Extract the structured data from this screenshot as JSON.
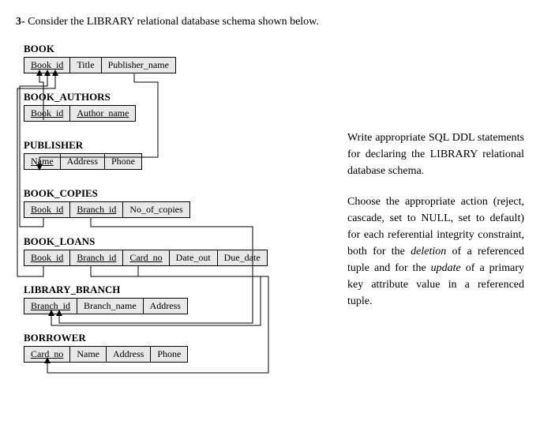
{
  "question": {
    "number": "3-",
    "text": "Consider the LIBRARY relational database schema shown below."
  },
  "schema": {
    "relations": [
      {
        "name": "BOOK",
        "attrs": [
          {
            "label": "Book_id",
            "pk": true
          },
          {
            "label": "Title",
            "pk": false
          },
          {
            "label": "Publisher_name",
            "pk": false
          }
        ]
      },
      {
        "name": "BOOK_AUTHORS",
        "attrs": [
          {
            "label": "Book_id",
            "pk": true
          },
          {
            "label": "Author_name",
            "pk": true
          }
        ]
      },
      {
        "name": "PUBLISHER",
        "attrs": [
          {
            "label": "Name",
            "pk": true
          },
          {
            "label": "Address",
            "pk": false
          },
          {
            "label": "Phone",
            "pk": false
          }
        ]
      },
      {
        "name": "BOOK_COPIES",
        "attrs": [
          {
            "label": "Book_id",
            "pk": true
          },
          {
            "label": "Branch_id",
            "pk": true
          },
          {
            "label": "No_of_copies",
            "pk": false
          }
        ]
      },
      {
        "name": "BOOK_LOANS",
        "attrs": [
          {
            "label": "Book_id",
            "pk": true
          },
          {
            "label": "Branch_id",
            "pk": true
          },
          {
            "label": "Card_no",
            "pk": true
          },
          {
            "label": "Date_out",
            "pk": false
          },
          {
            "label": "Due_date",
            "pk": false
          }
        ]
      },
      {
        "name": "LIBRARY_BRANCH",
        "attrs": [
          {
            "label": "Branch_id",
            "pk": true
          },
          {
            "label": "Branch_name",
            "pk": false
          },
          {
            "label": "Address",
            "pk": false
          }
        ]
      },
      {
        "name": "BORROWER",
        "attrs": [
          {
            "label": "Card_no",
            "pk": true
          },
          {
            "label": "Name",
            "pk": false
          },
          {
            "label": "Address",
            "pk": false
          },
          {
            "label": "Phone",
            "pk": false
          }
        ]
      }
    ]
  },
  "instructions": {
    "p1_a": "Write appropriate SQL DDL statements for declaring the LIBRARY relational database schema.",
    "p2_a": "Choose the appropriate action (reject, cascade, set to NULL, set to default) for each referential integrity constraint, both for the ",
    "p2_del": "deletion",
    "p2_b": " of a referenced tuple and for the ",
    "p2_upd": "update",
    "p2_c": " of a primary key attribute value in a referenced tuple."
  }
}
